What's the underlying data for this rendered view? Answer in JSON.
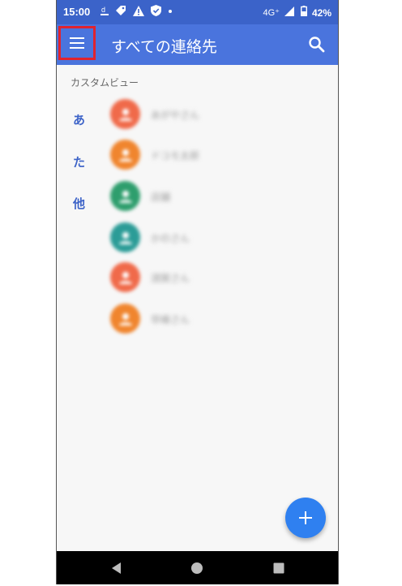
{
  "status_bar": {
    "time": "15:00",
    "network": "4G⁺",
    "battery": "42%",
    "notification_icons": [
      "docomo-icon",
      "tag-icon",
      "warning-icon",
      "shield-icon",
      "dot-icon"
    ]
  },
  "app_bar": {
    "title": "すべての連絡先"
  },
  "list": {
    "section_label": "カスタムビュー",
    "index_letters": [
      "あ",
      "た",
      "他"
    ],
    "contacts": [
      {
        "name": "あがやさん",
        "color": "#f06a4a"
      },
      {
        "name": "ドコモ太郎",
        "color": "#f0852e"
      },
      {
        "name": "店舗",
        "color": "#2e9e6d"
      },
      {
        "name": "かのさん",
        "color": "#2b9c97"
      },
      {
        "name": "須賀さん",
        "color": "#f06a4a"
      },
      {
        "name": "早峰さん",
        "color": "#f0852e"
      }
    ]
  },
  "fab": {
    "label": "+"
  },
  "colors": {
    "status_bar": "#3b63c9",
    "app_bar": "#4a74dd",
    "accent": "#2f80f0",
    "highlight_box": "#e0232f"
  }
}
